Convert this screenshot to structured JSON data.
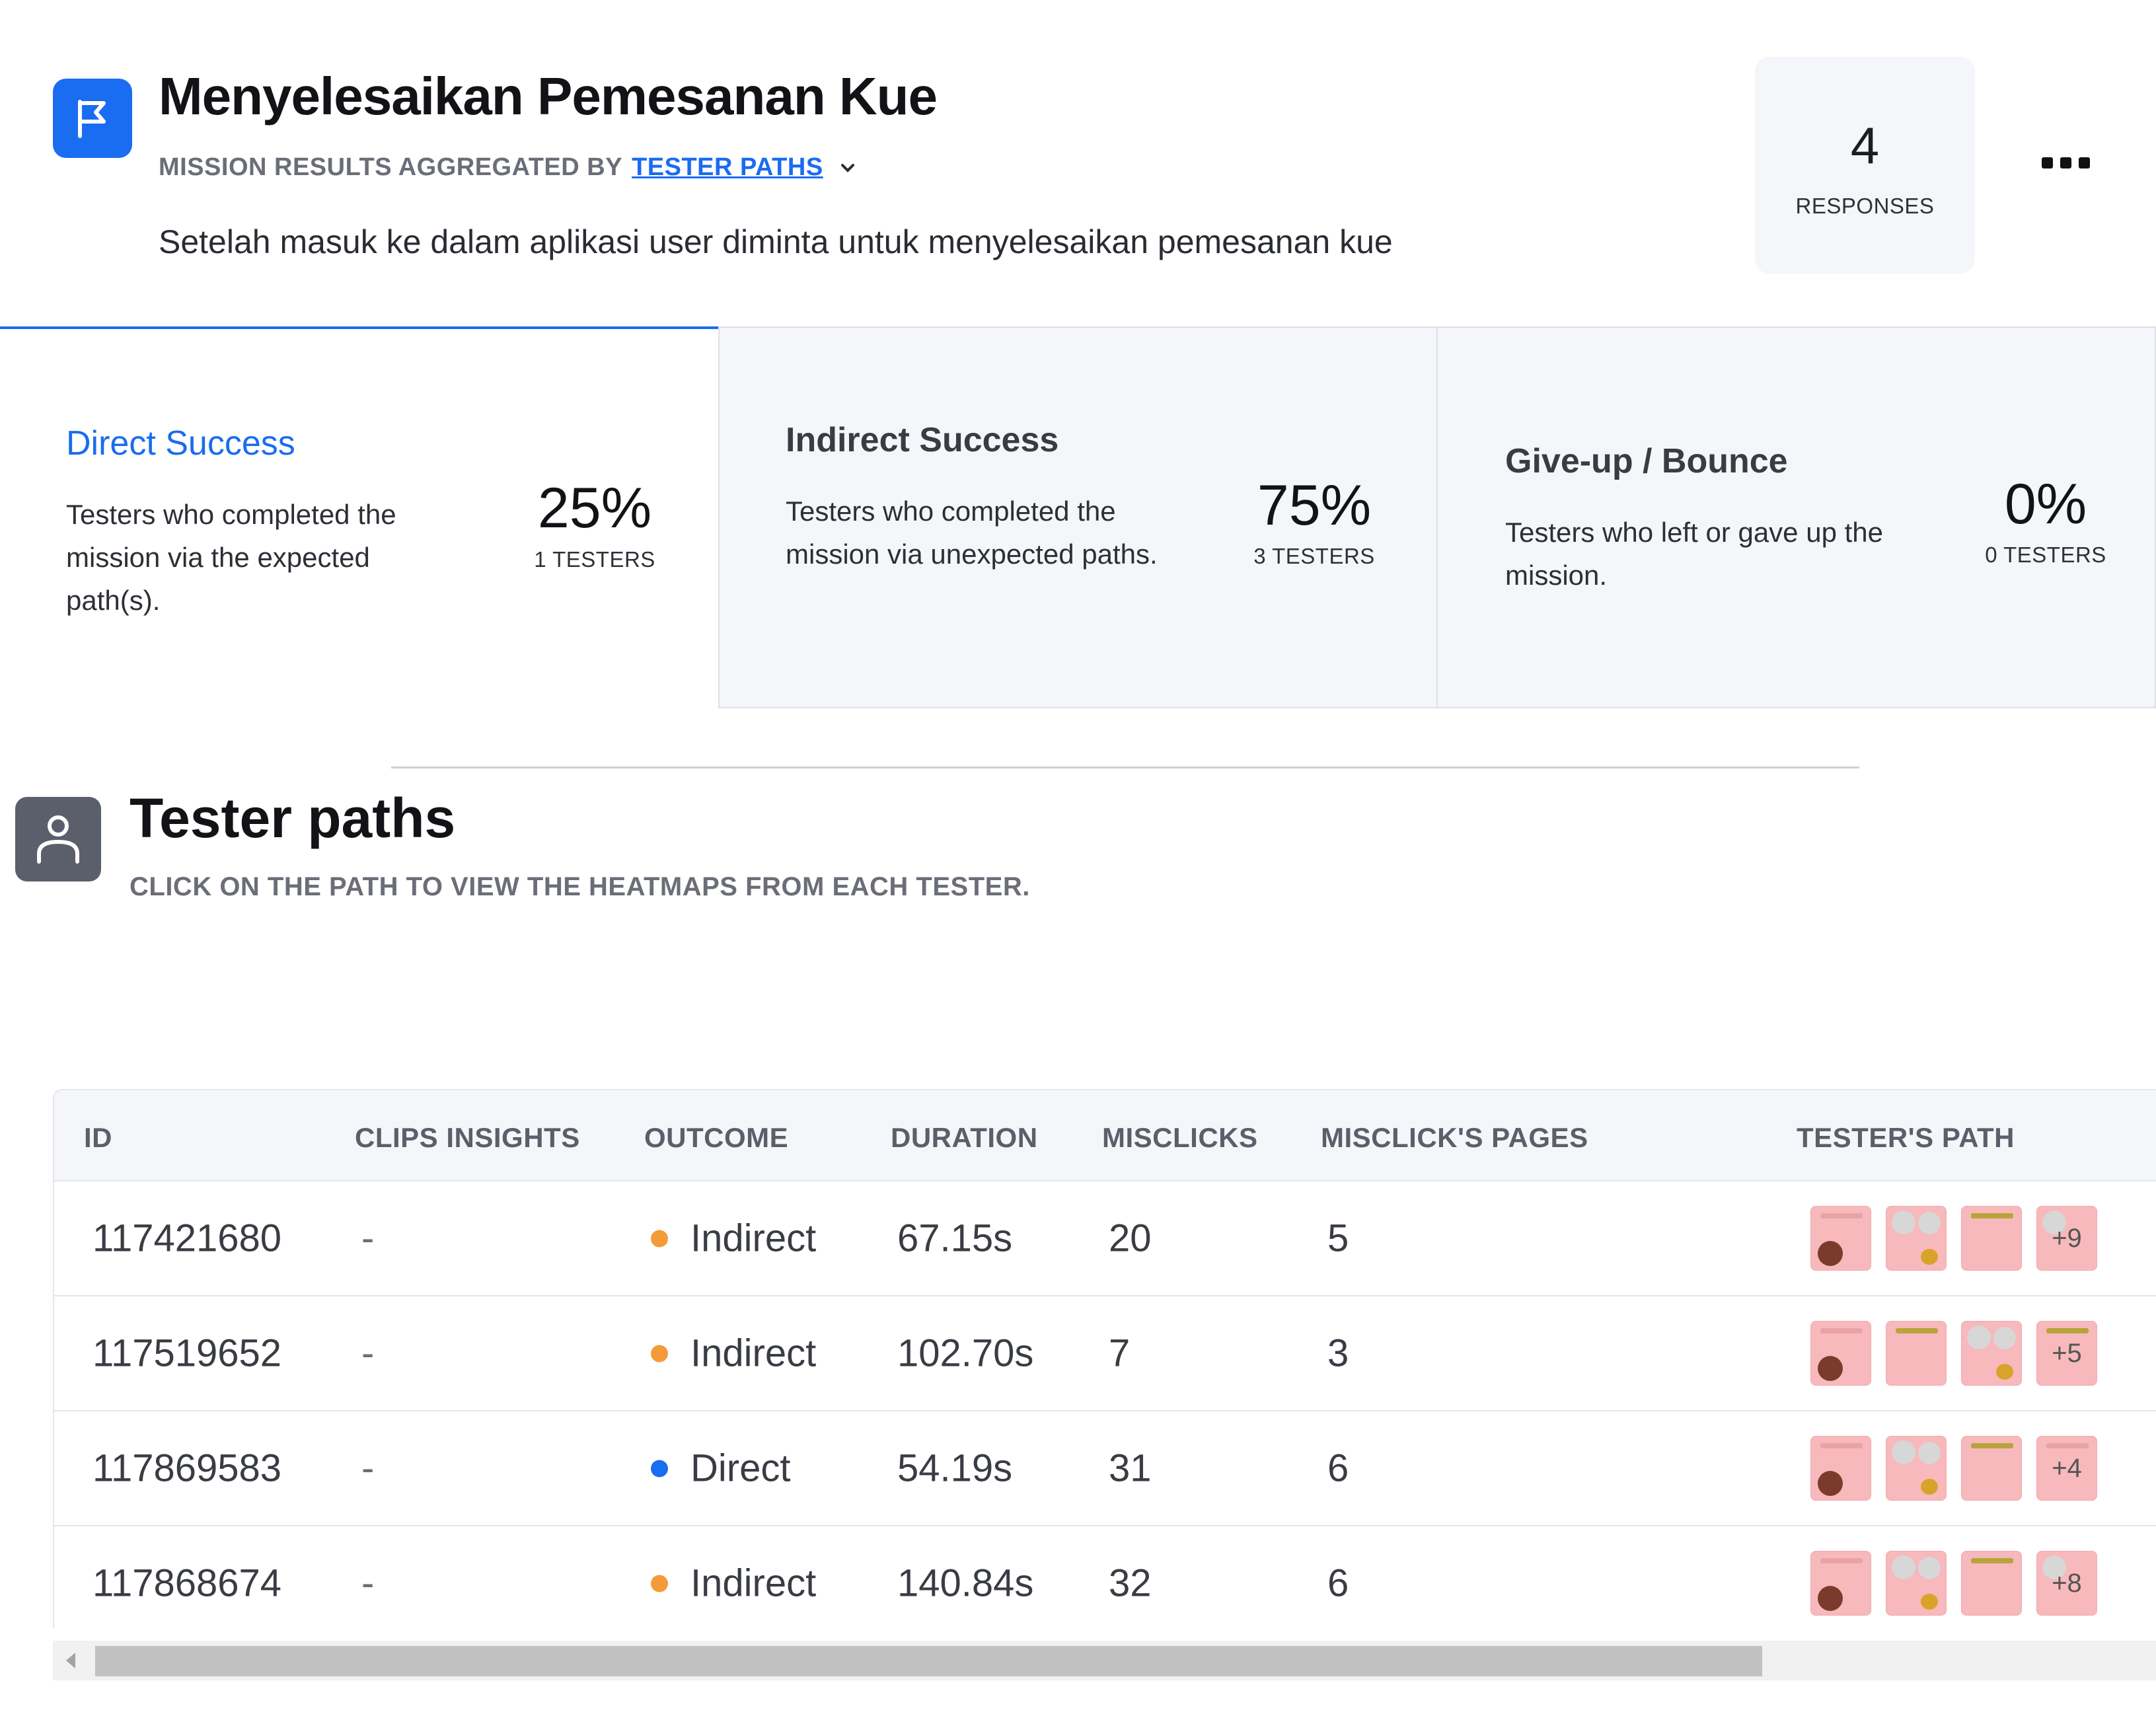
{
  "header": {
    "title": "Menyelesaikan Pemesanan Kue",
    "subtitle_prefix": "MISSION RESULTS AGGREGATED BY",
    "subtitle_link": "TESTER PATHS",
    "description": "Setelah masuk ke dalam aplikasi user diminta untuk menyelesaikan pemesanan kue",
    "responses_count": "4",
    "responses_label": "RESPONSES"
  },
  "outcomes": [
    {
      "title": "Direct Success",
      "description": "Testers who completed the mission via the expected path(s).",
      "percent": "25%",
      "count": "1 TESTERS"
    },
    {
      "title": "Indirect Success",
      "description": "Testers who completed the mission via unexpected paths.",
      "percent": "75%",
      "count": "3 TESTERS"
    },
    {
      "title": "Give-up / Bounce",
      "description": "Testers who left or gave up the mission.",
      "percent": "0%",
      "count": "0 TESTERS"
    }
  ],
  "tester_paths": {
    "title": "Tester paths",
    "subtitle": "CLICK ON THE PATH TO VIEW THE HEATMAPS FROM EACH TESTER."
  },
  "table": {
    "columns": [
      "ID",
      "CLIPS INSIGHTS",
      "OUTCOME",
      "DURATION",
      "MISCLICKS",
      "MISCLICK'S PAGES",
      "TESTER'S PATH"
    ],
    "rows": [
      {
        "id": "117421680",
        "clips": "-",
        "outcome": "Indirect",
        "outcome_type": "indirect",
        "duration": "67.15s",
        "misclicks": "20",
        "pages": "5",
        "more": "+9"
      },
      {
        "id": "117519652",
        "clips": "-",
        "outcome": "Indirect",
        "outcome_type": "indirect",
        "duration": "102.70s",
        "misclicks": "7",
        "pages": "3",
        "more": "+5"
      },
      {
        "id": "117869583",
        "clips": "-",
        "outcome": "Direct",
        "outcome_type": "direct",
        "duration": "54.19s",
        "misclicks": "31",
        "pages": "6",
        "more": "+4"
      },
      {
        "id": "117868674",
        "clips": "-",
        "outcome": "Indirect",
        "outcome_type": "indirect",
        "duration": "140.84s",
        "misclicks": "32",
        "pages": "6",
        "more": "+8"
      }
    ]
  },
  "colors": {
    "accent": "#1a6cf0",
    "indirect": "#f59a38",
    "direct": "#1a6cf0",
    "thumb": "#f7b9bb"
  },
  "icons": {
    "mission": "flag-icon",
    "tester_paths": "person-icon",
    "subtitle_dropdown": "chevron-down-icon",
    "menu": "more-horizontal-icon"
  }
}
